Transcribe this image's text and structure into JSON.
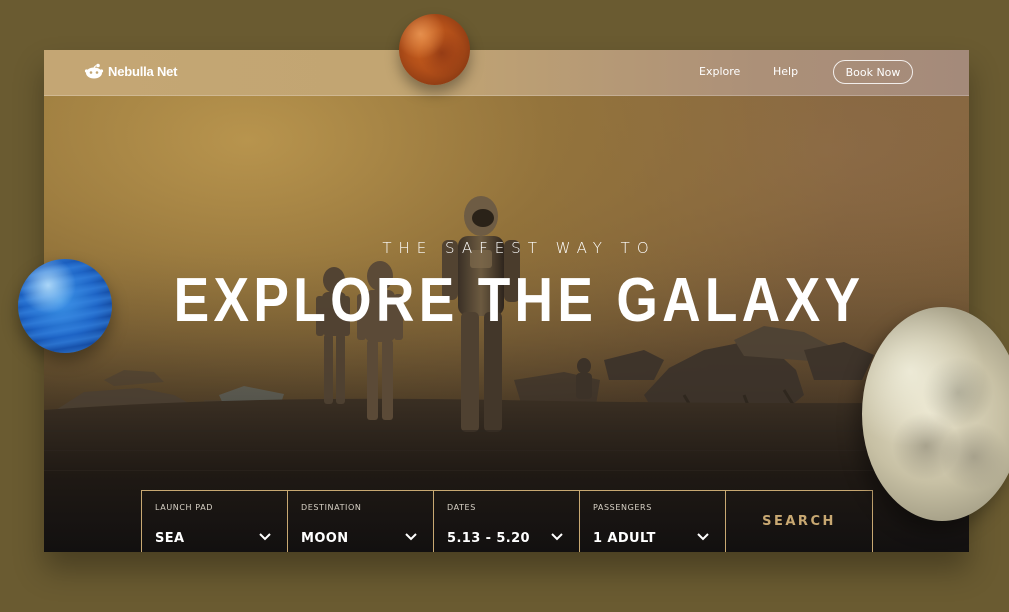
{
  "header": {
    "brand": "Nebulla Net",
    "nav": {
      "explore": "Explore",
      "help": "Help",
      "book_now": "Book Now"
    }
  },
  "hero": {
    "subtitle": "THE SAFEST WAY TO",
    "title": "EXPLORE THE GALAXY"
  },
  "search": {
    "fields": [
      {
        "label": "LAUNCH PAD",
        "value": "SEA"
      },
      {
        "label": "DESTINATION",
        "value": "MOON"
      },
      {
        "label": "DATES",
        "value": "5.13 - 5.20"
      },
      {
        "label": "PASSENGERS",
        "value": "1 ADULT"
      }
    ],
    "button": "SEARCH"
  },
  "colors": {
    "background": "#6a5b31",
    "accent": "#c8a872"
  }
}
